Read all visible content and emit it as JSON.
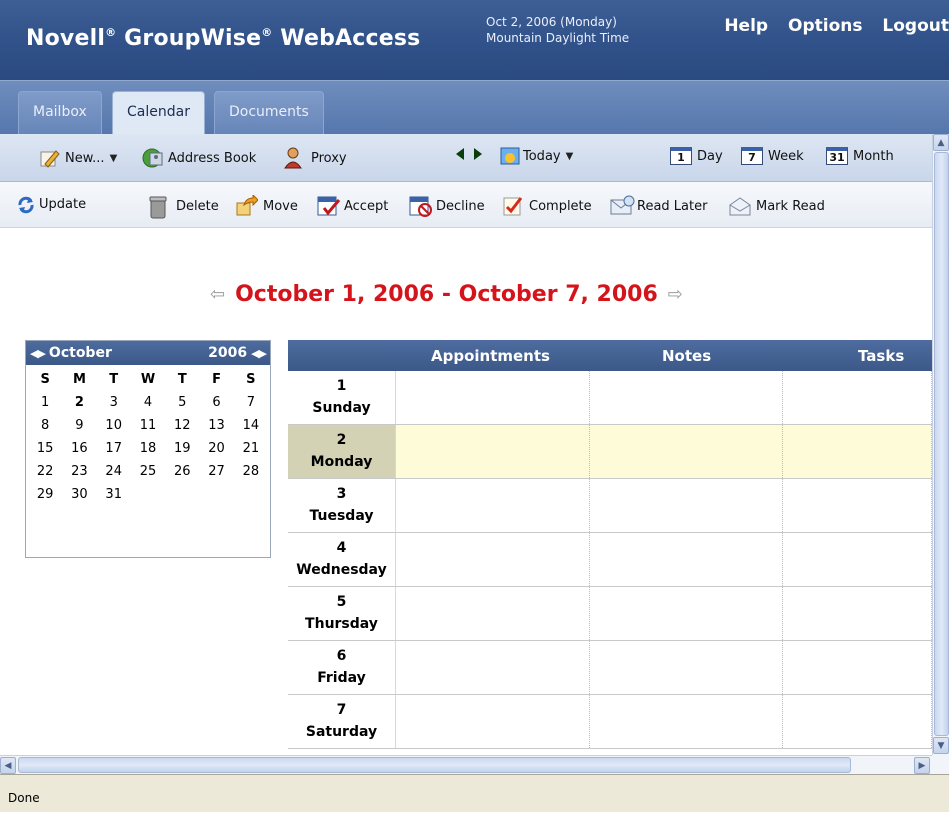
{
  "header": {
    "brand_name": "Novell",
    "brand_reg": "®",
    "brand_product": " GroupWise",
    "brand_reg2": "®",
    "brand_suffix": " WebAccess",
    "date_line": "Oct 2, 2006 (Monday)",
    "timezone_line": "Mountain Daylight Time",
    "links": {
      "help": "Help",
      "options": "Options",
      "logout": "Logout"
    }
  },
  "tabs": [
    {
      "label": "Mailbox",
      "active": false
    },
    {
      "label": "Calendar",
      "active": true
    },
    {
      "label": "Documents",
      "active": false
    }
  ],
  "toolbar1": {
    "new_label": "New...",
    "address_book_label": "Address Book",
    "proxy_label": "Proxy",
    "today_label": "Today",
    "day_label": "Day",
    "day_icon_num": "1",
    "week_label": "Week",
    "week_icon_num": "7",
    "month_label": "Month",
    "month_icon_num": "31"
  },
  "toolbar2": {
    "update": "Update",
    "delete": "Delete",
    "move": "Move",
    "accept": "Accept",
    "decline": "Decline",
    "complete": "Complete",
    "read_later": "Read Later",
    "mark_read": "Mark Read"
  },
  "week_heading": {
    "title": "October 1, 2006 - October 7, 2006",
    "prev_arrow": "⇦",
    "next_arrow": "⇨"
  },
  "mini_calendar": {
    "month_arrows": "◀▶",
    "month": "October",
    "year": "2006",
    "year_arrows": "◀▶",
    "days_of_week": [
      "S",
      "M",
      "T",
      "W",
      "T",
      "F",
      "S"
    ],
    "weeks": [
      [
        "1",
        "2",
        "3",
        "4",
        "5",
        "6",
        "7"
      ],
      [
        "8",
        "9",
        "10",
        "11",
        "12",
        "13",
        "14"
      ],
      [
        "15",
        "16",
        "17",
        "18",
        "19",
        "20",
        "21"
      ],
      [
        "22",
        "23",
        "24",
        "25",
        "26",
        "27",
        "28"
      ],
      [
        "29",
        "30",
        "31",
        "",
        "",
        "",
        ""
      ]
    ],
    "today": "2"
  },
  "week_table": {
    "columns": {
      "appointments": "Appointments",
      "notes": "Notes",
      "tasks": "Tasks"
    },
    "rows": [
      {
        "num": "1",
        "day": "Sunday",
        "today": false
      },
      {
        "num": "2",
        "day": "Monday",
        "today": true
      },
      {
        "num": "3",
        "day": "Tuesday",
        "today": false
      },
      {
        "num": "4",
        "day": "Wednesday",
        "today": false
      },
      {
        "num": "5",
        "day": "Thursday",
        "today": false
      },
      {
        "num": "6",
        "day": "Friday",
        "today": false
      },
      {
        "num": "7",
        "day": "Saturday",
        "today": false
      }
    ]
  },
  "status": {
    "text": "Done"
  },
  "colors": {
    "header_bg": "#2f5088",
    "title_red": "#d4141a",
    "today_row": "#fdfbd8",
    "today_day_cell": "#d4d2b4"
  }
}
